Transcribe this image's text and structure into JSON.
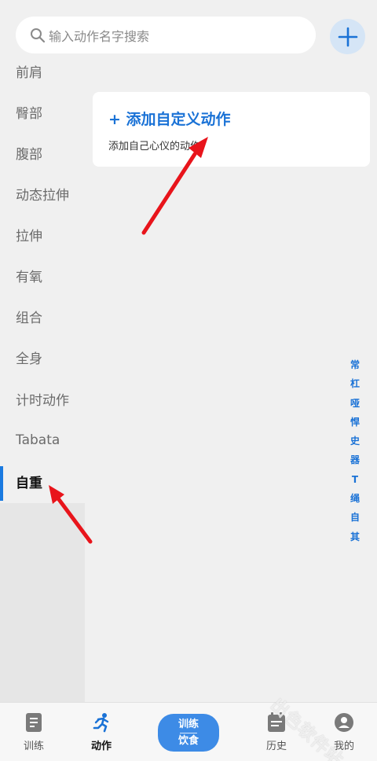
{
  "search": {
    "placeholder": "输入动作名字搜索"
  },
  "sidebar": {
    "items": [
      {
        "label": "前肩"
      },
      {
        "label": "臀部"
      },
      {
        "label": "腹部"
      },
      {
        "label": "动态拉伸"
      },
      {
        "label": "拉伸"
      },
      {
        "label": "有氧"
      },
      {
        "label": "组合"
      },
      {
        "label": "全身"
      },
      {
        "label": "计时动作"
      },
      {
        "label": "Tabata"
      },
      {
        "label": "自重"
      }
    ],
    "active_index": 10
  },
  "card": {
    "title": "+ 添加自定义动作",
    "subtitle": "添加自己心仪的动作"
  },
  "index_letters": [
    "常",
    "杠",
    "哑",
    "悍",
    "史",
    "器",
    "T",
    "绳",
    "自",
    "其"
  ],
  "bottom_nav": {
    "items": [
      {
        "label": "训练",
        "icon": "training-icon"
      },
      {
        "label": "动作",
        "icon": "running-icon"
      },
      {
        "label": "历史",
        "icon": "calendar-icon"
      },
      {
        "label": "我的",
        "icon": "profile-icon"
      }
    ],
    "center": {
      "line1": "训练",
      "line2": "饮食"
    },
    "active_label": "动作"
  },
  "watermark": "出色软件站",
  "colors": {
    "accent": "#1a72d6",
    "annotation": "#e8141b"
  }
}
